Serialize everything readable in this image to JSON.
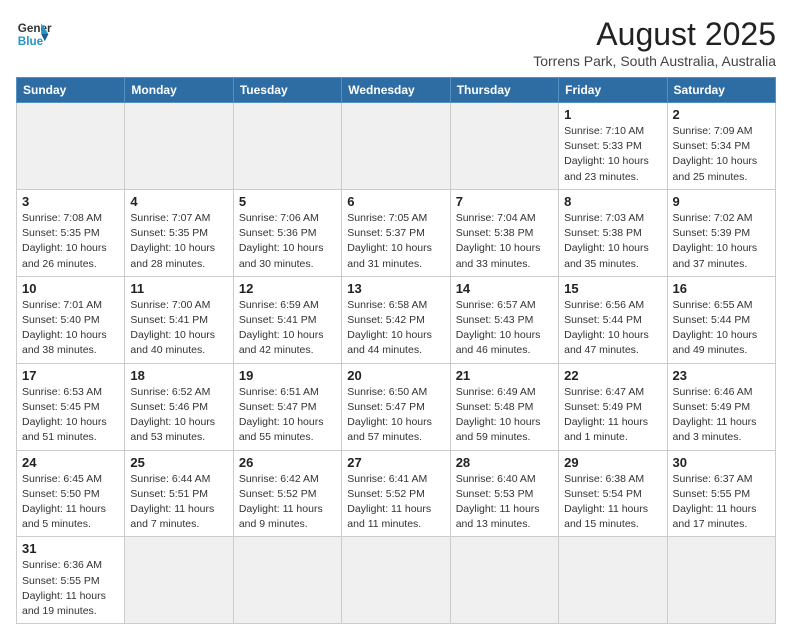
{
  "header": {
    "logo_general": "General",
    "logo_blue": "Blue",
    "title": "August 2025",
    "subtitle": "Torrens Park, South Australia, Australia"
  },
  "weekdays": [
    "Sunday",
    "Monday",
    "Tuesday",
    "Wednesday",
    "Thursday",
    "Friday",
    "Saturday"
  ],
  "weeks": [
    [
      {
        "day": "",
        "info": ""
      },
      {
        "day": "",
        "info": ""
      },
      {
        "day": "",
        "info": ""
      },
      {
        "day": "",
        "info": ""
      },
      {
        "day": "",
        "info": ""
      },
      {
        "day": "1",
        "info": "Sunrise: 7:10 AM\nSunset: 5:33 PM\nDaylight: 10 hours and 23 minutes."
      },
      {
        "day": "2",
        "info": "Sunrise: 7:09 AM\nSunset: 5:34 PM\nDaylight: 10 hours and 25 minutes."
      }
    ],
    [
      {
        "day": "3",
        "info": "Sunrise: 7:08 AM\nSunset: 5:35 PM\nDaylight: 10 hours and 26 minutes."
      },
      {
        "day": "4",
        "info": "Sunrise: 7:07 AM\nSunset: 5:35 PM\nDaylight: 10 hours and 28 minutes."
      },
      {
        "day": "5",
        "info": "Sunrise: 7:06 AM\nSunset: 5:36 PM\nDaylight: 10 hours and 30 minutes."
      },
      {
        "day": "6",
        "info": "Sunrise: 7:05 AM\nSunset: 5:37 PM\nDaylight: 10 hours and 31 minutes."
      },
      {
        "day": "7",
        "info": "Sunrise: 7:04 AM\nSunset: 5:38 PM\nDaylight: 10 hours and 33 minutes."
      },
      {
        "day": "8",
        "info": "Sunrise: 7:03 AM\nSunset: 5:38 PM\nDaylight: 10 hours and 35 minutes."
      },
      {
        "day": "9",
        "info": "Sunrise: 7:02 AM\nSunset: 5:39 PM\nDaylight: 10 hours and 37 minutes."
      }
    ],
    [
      {
        "day": "10",
        "info": "Sunrise: 7:01 AM\nSunset: 5:40 PM\nDaylight: 10 hours and 38 minutes."
      },
      {
        "day": "11",
        "info": "Sunrise: 7:00 AM\nSunset: 5:41 PM\nDaylight: 10 hours and 40 minutes."
      },
      {
        "day": "12",
        "info": "Sunrise: 6:59 AM\nSunset: 5:41 PM\nDaylight: 10 hours and 42 minutes."
      },
      {
        "day": "13",
        "info": "Sunrise: 6:58 AM\nSunset: 5:42 PM\nDaylight: 10 hours and 44 minutes."
      },
      {
        "day": "14",
        "info": "Sunrise: 6:57 AM\nSunset: 5:43 PM\nDaylight: 10 hours and 46 minutes."
      },
      {
        "day": "15",
        "info": "Sunrise: 6:56 AM\nSunset: 5:44 PM\nDaylight: 10 hours and 47 minutes."
      },
      {
        "day": "16",
        "info": "Sunrise: 6:55 AM\nSunset: 5:44 PM\nDaylight: 10 hours and 49 minutes."
      }
    ],
    [
      {
        "day": "17",
        "info": "Sunrise: 6:53 AM\nSunset: 5:45 PM\nDaylight: 10 hours and 51 minutes."
      },
      {
        "day": "18",
        "info": "Sunrise: 6:52 AM\nSunset: 5:46 PM\nDaylight: 10 hours and 53 minutes."
      },
      {
        "day": "19",
        "info": "Sunrise: 6:51 AM\nSunset: 5:47 PM\nDaylight: 10 hours and 55 minutes."
      },
      {
        "day": "20",
        "info": "Sunrise: 6:50 AM\nSunset: 5:47 PM\nDaylight: 10 hours and 57 minutes."
      },
      {
        "day": "21",
        "info": "Sunrise: 6:49 AM\nSunset: 5:48 PM\nDaylight: 10 hours and 59 minutes."
      },
      {
        "day": "22",
        "info": "Sunrise: 6:47 AM\nSunset: 5:49 PM\nDaylight: 11 hours and 1 minute."
      },
      {
        "day": "23",
        "info": "Sunrise: 6:46 AM\nSunset: 5:49 PM\nDaylight: 11 hours and 3 minutes."
      }
    ],
    [
      {
        "day": "24",
        "info": "Sunrise: 6:45 AM\nSunset: 5:50 PM\nDaylight: 11 hours and 5 minutes."
      },
      {
        "day": "25",
        "info": "Sunrise: 6:44 AM\nSunset: 5:51 PM\nDaylight: 11 hours and 7 minutes."
      },
      {
        "day": "26",
        "info": "Sunrise: 6:42 AM\nSunset: 5:52 PM\nDaylight: 11 hours and 9 minutes."
      },
      {
        "day": "27",
        "info": "Sunrise: 6:41 AM\nSunset: 5:52 PM\nDaylight: 11 hours and 11 minutes."
      },
      {
        "day": "28",
        "info": "Sunrise: 6:40 AM\nSunset: 5:53 PM\nDaylight: 11 hours and 13 minutes."
      },
      {
        "day": "29",
        "info": "Sunrise: 6:38 AM\nSunset: 5:54 PM\nDaylight: 11 hours and 15 minutes."
      },
      {
        "day": "30",
        "info": "Sunrise: 6:37 AM\nSunset: 5:55 PM\nDaylight: 11 hours and 17 minutes."
      }
    ],
    [
      {
        "day": "31",
        "info": "Sunrise: 6:36 AM\nSunset: 5:55 PM\nDaylight: 11 hours and 19 minutes."
      },
      {
        "day": "",
        "info": ""
      },
      {
        "day": "",
        "info": ""
      },
      {
        "day": "",
        "info": ""
      },
      {
        "day": "",
        "info": ""
      },
      {
        "day": "",
        "info": ""
      },
      {
        "day": "",
        "info": ""
      }
    ]
  ]
}
